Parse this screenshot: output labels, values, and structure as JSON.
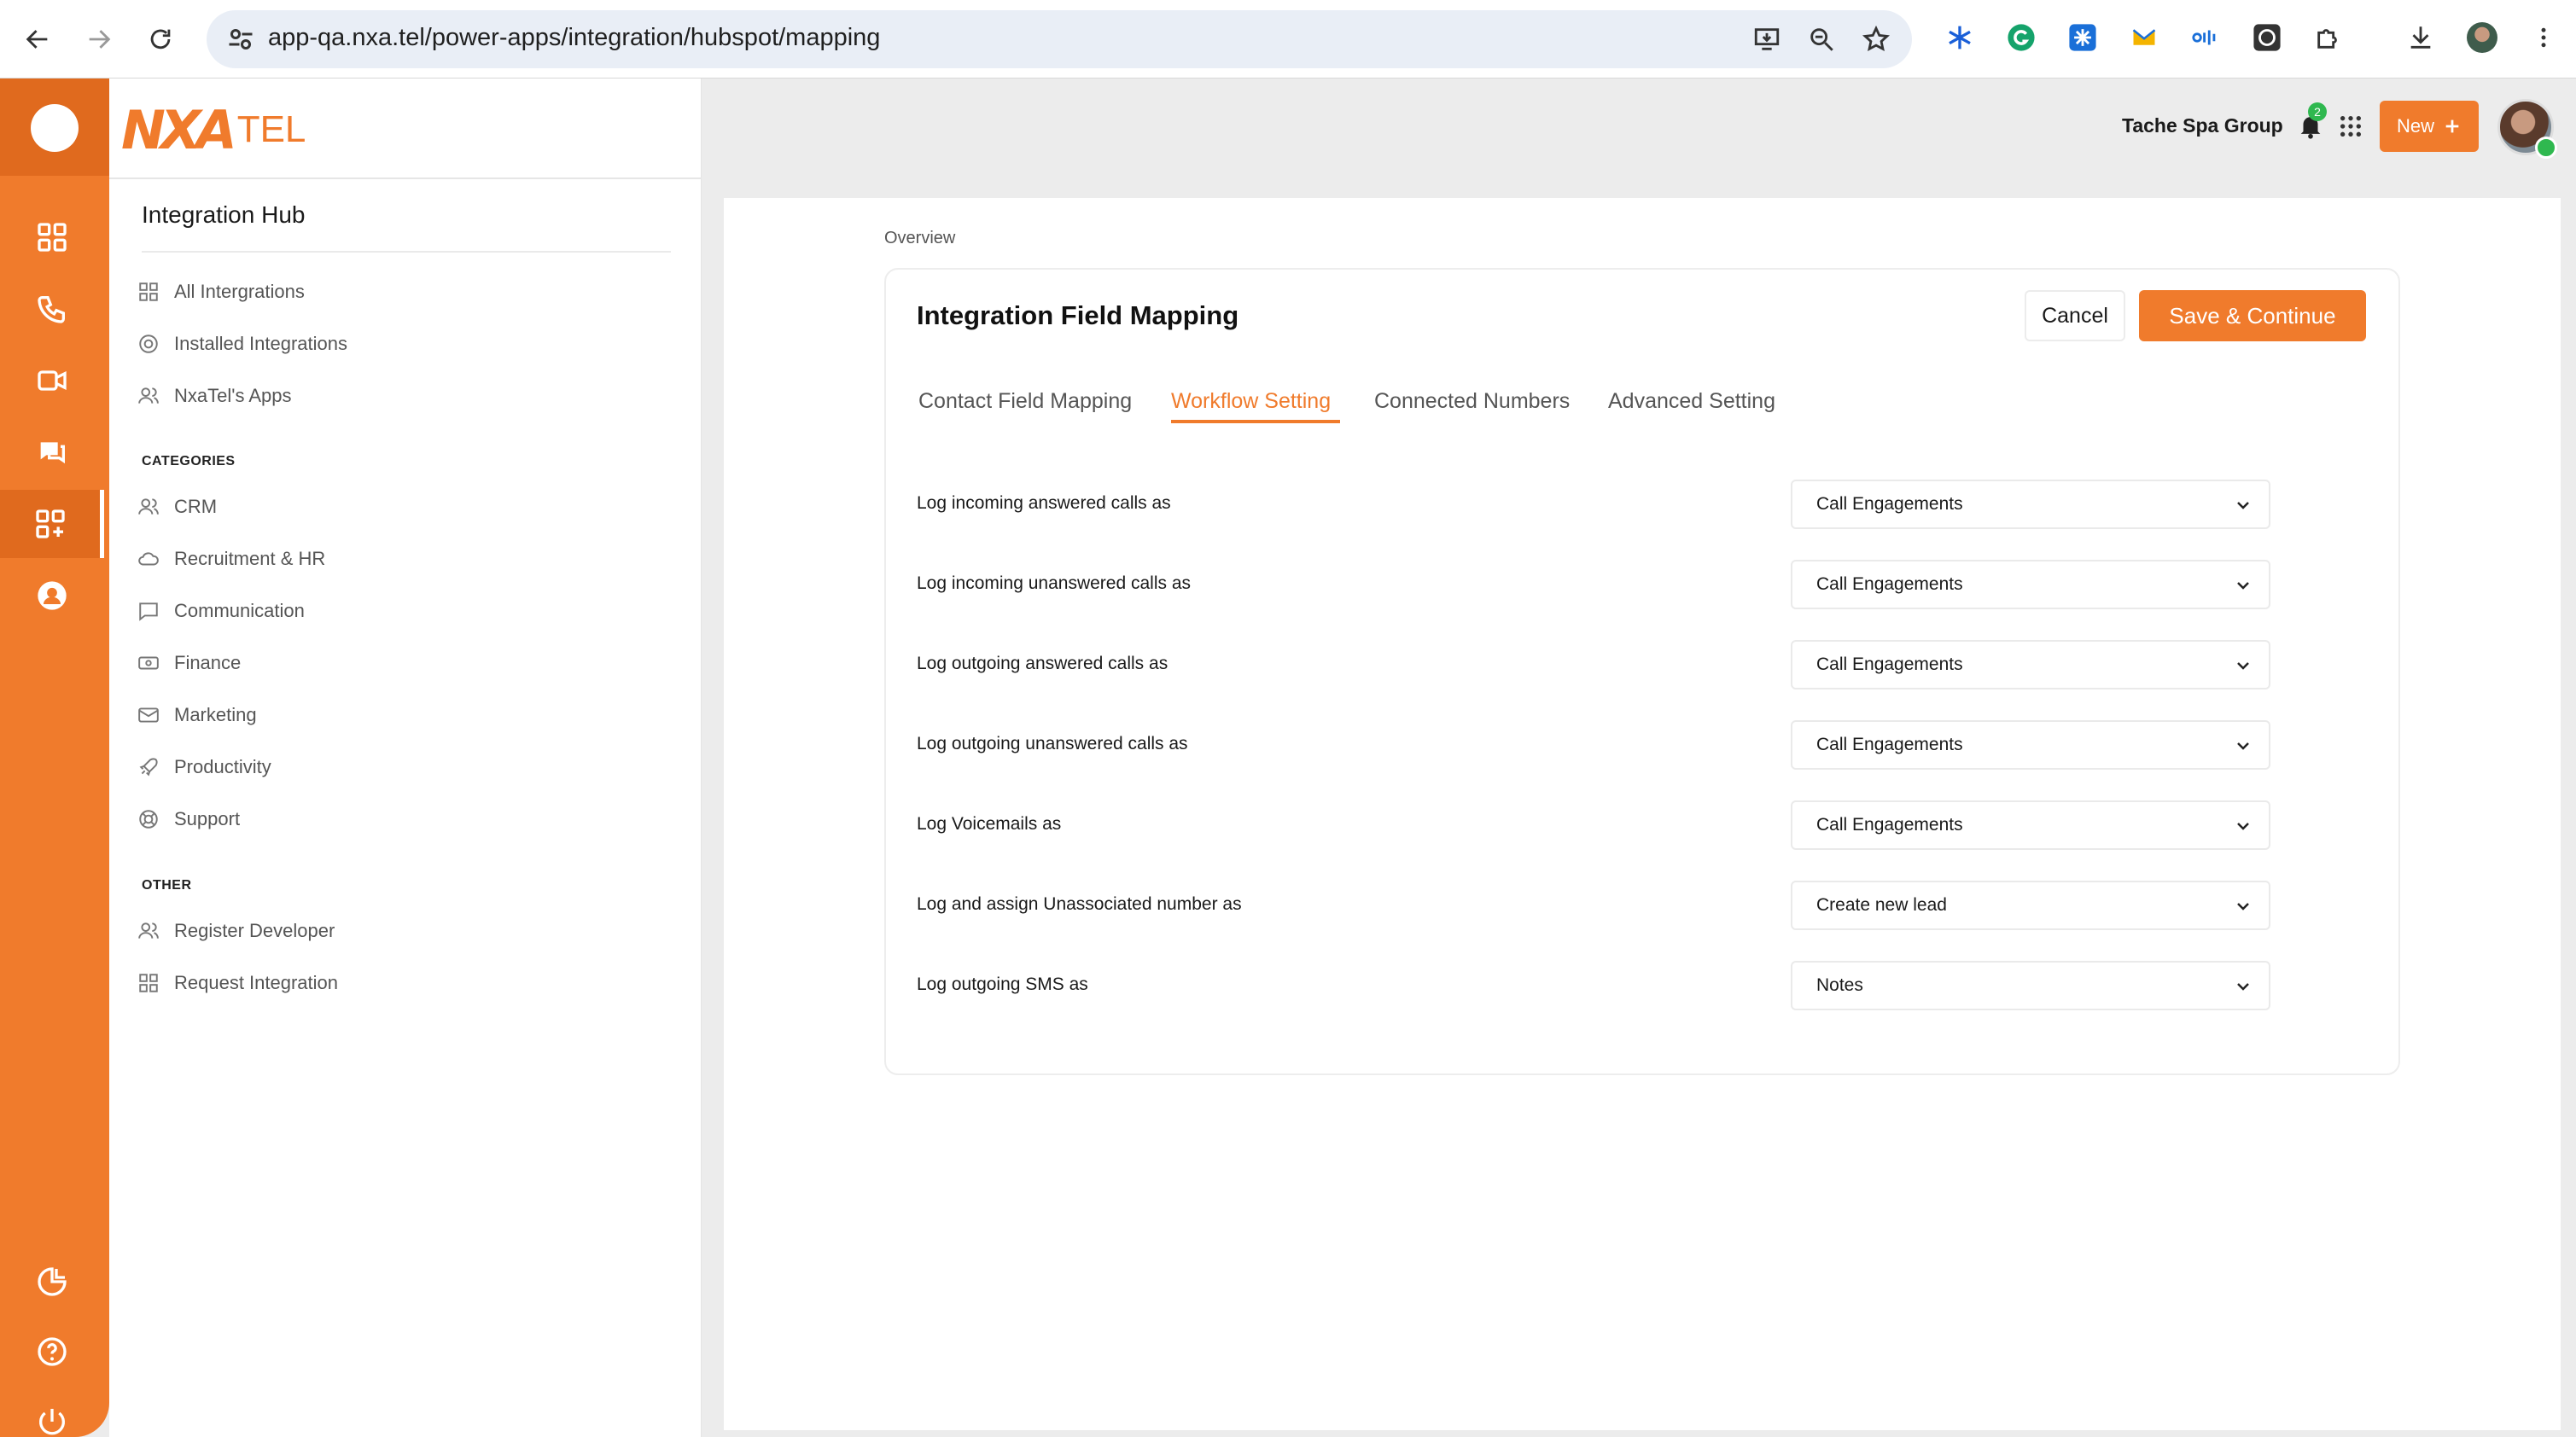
{
  "browser": {
    "url": "app-qa.nxa.tel/power-apps/integration/hubspot/mapping"
  },
  "brand": {
    "logo_nxa": "NXA",
    "logo_tel": "TEL",
    "accent_color": "#f07b2c"
  },
  "sidebar": {
    "hub_title": "Integration Hub",
    "items": [
      {
        "label": "All Intergrations",
        "icon": "grid-icon"
      },
      {
        "label": "Installed Integrations",
        "icon": "clock-icon"
      },
      {
        "label": "NxaTel's Apps",
        "icon": "users-icon"
      }
    ],
    "categories_label": "CATEGORIES",
    "categories": [
      {
        "label": "CRM",
        "icon": "users-icon"
      },
      {
        "label": "Recruitment & HR",
        "icon": "cloud-icon"
      },
      {
        "label": "Communication",
        "icon": "chat-icon"
      },
      {
        "label": "Finance",
        "icon": "money-icon"
      },
      {
        "label": "Marketing",
        "icon": "mail-icon"
      },
      {
        "label": "Productivity",
        "icon": "rocket-icon"
      },
      {
        "label": "Support",
        "icon": "lifebuoy-icon"
      }
    ],
    "other_label": "OTHER",
    "other": [
      {
        "label": "Register Developer",
        "icon": "users-icon"
      },
      {
        "label": "Request Integration",
        "icon": "grid-icon"
      }
    ]
  },
  "header": {
    "org_name": "Tache Spa Group",
    "notification_count": "2",
    "new_label": "New"
  },
  "main": {
    "breadcrumb": "Overview",
    "title": "Integration Field Mapping",
    "cancel_label": "Cancel",
    "save_label": "Save & Continue",
    "tabs": [
      {
        "label": "Contact Field Mapping",
        "active": false
      },
      {
        "label": "Workflow Setting",
        "active": true
      },
      {
        "label": "Connected Numbers",
        "active": false
      },
      {
        "label": "Advanced Setting",
        "active": false
      }
    ],
    "rows": [
      {
        "label": "Log incoming answered calls as",
        "value": "Call Engagements"
      },
      {
        "label": "Log incoming unanswered calls as",
        "value": "Call Engagements"
      },
      {
        "label": "Log outgoing answered calls as",
        "value": "Call Engagements"
      },
      {
        "label": "Log outgoing unanswered calls as",
        "value": "Call Engagements"
      },
      {
        "label": "Log Voicemails as",
        "value": "Call Engagements"
      },
      {
        "label": "Log and assign Unassociated number as",
        "value": "Create new lead"
      },
      {
        "label": "Log outgoing SMS as",
        "value": "Notes"
      }
    ]
  }
}
